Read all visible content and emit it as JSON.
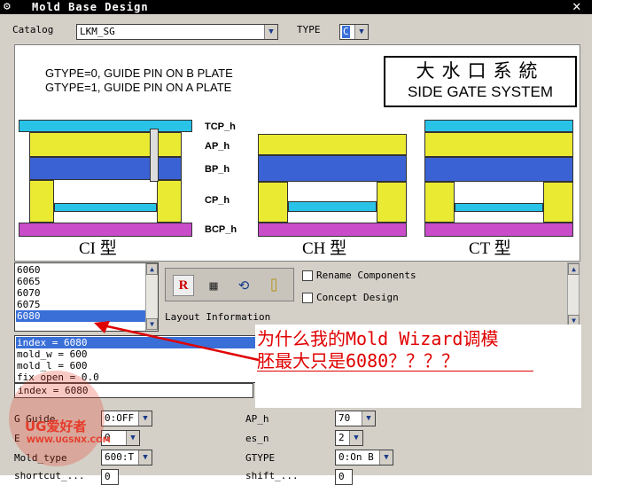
{
  "window": {
    "title": "Mold Base Design",
    "title_icon": "gear-icon",
    "close_glyph": "✕"
  },
  "header": {
    "catalog_label": "Catalog",
    "catalog_value": "LKM_SG",
    "type_label": "TYPE",
    "type_value": "C"
  },
  "diagram": {
    "gtype_line1": "GTYPE=0, GUIDE PIN ON B PLATE",
    "gtype_line2": "GTYPE=1, GUIDE PIN ON A PLATE",
    "title_cn": "大水口系統",
    "title_en": "SIDE GATE SYSTEM",
    "plate_labels": [
      "TCP_h",
      "AP_h",
      "BP_h",
      "CP_h",
      "BCP_h"
    ],
    "types": [
      "CI 型",
      "CH 型",
      "CT 型"
    ],
    "colors": {
      "cyan": "#29c3e8",
      "yellow": "#eaea33",
      "blue": "#3b62d4",
      "magenta": "#c94cc9"
    }
  },
  "size_list": {
    "items": [
      "6060",
      "6065",
      "6070",
      "6075",
      "6080"
    ],
    "selected": "6080"
  },
  "tools": {
    "icons": [
      "component-r-icon",
      "table-icon",
      "rotate-icon",
      "measure-icon"
    ],
    "glyphs": [
      "R",
      "▦",
      "⟲",
      "⌷"
    ]
  },
  "options": {
    "rename": "Rename Components",
    "concept": "Concept Design",
    "layout_info": "Layout Information"
  },
  "expr_list": {
    "items": [
      "index = 6080",
      "mold_w = 600",
      "mold_l = 600",
      "fix_open = 0.0"
    ]
  },
  "expr_field": {
    "value": "index = 6080"
  },
  "params": {
    "left": [
      {
        "label": "G Guide",
        "value": "0:OFF"
      },
      {
        "label": "E",
        "value": "0"
      },
      {
        "label": "Mold_type",
        "value": "600:T"
      },
      {
        "label": "shortcut_...",
        "value": "0"
      }
    ],
    "right": [
      {
        "label": "AP_h",
        "value": "70"
      },
      {
        "label": "es_n",
        "value": "2"
      },
      {
        "label": "GTYPE",
        "value": "0:On B"
      },
      {
        "label": "shift_...",
        "value": "0"
      }
    ]
  },
  "annotation": {
    "line1": "为什么我的Mold Wizard调模",
    "line2": "胚最大只是6080？？？？"
  },
  "watermark": {
    "text1": "UG爱好者",
    "text2": "WWW.UGSNX.COM"
  }
}
